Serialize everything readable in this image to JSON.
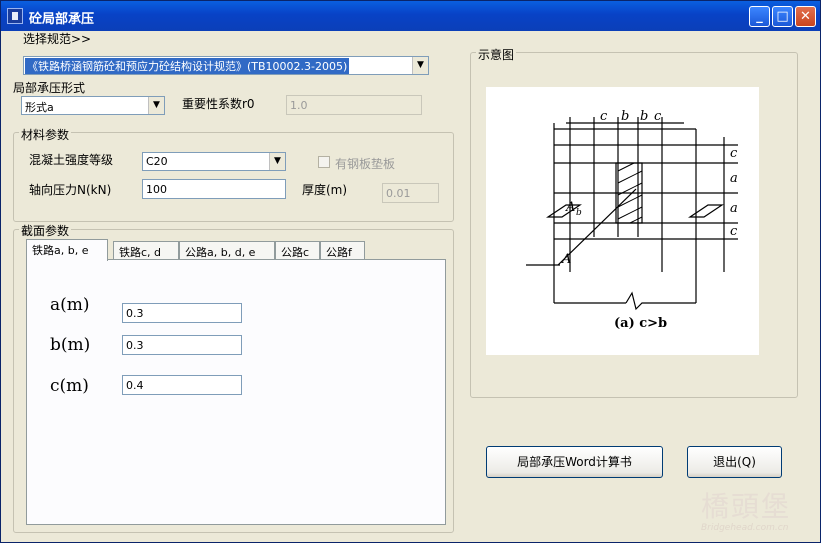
{
  "window": {
    "title": "砼局部承压",
    "buttons": {
      "minimize": "_",
      "maximize": "□",
      "close": "✕"
    }
  },
  "spec": {
    "label": "选择规范>>",
    "value": "《铁路桥涵钢筋砼和预应力砼结构设计规范》(TB10002.3-2005)"
  },
  "form_type": {
    "label": "局部承压形式",
    "value": "形式a"
  },
  "importance": {
    "label": "重要性系数r0",
    "value": "1.0"
  },
  "materials": {
    "title": "材料参数",
    "concrete_label": "混凝土强度等级",
    "concrete_value": "C20",
    "steel_plate_label": "有钢板垫板",
    "axial_label": "轴向压力N(kN)",
    "axial_value": "100",
    "thickness_label": "厚度(m)",
    "thickness_value": "0.01"
  },
  "section": {
    "title": "截面参数",
    "tabs": [
      "铁路a, b, e",
      "铁路c, d",
      "公路a, b, d, e",
      "公路c",
      "公路f"
    ],
    "params": [
      {
        "label": "a(m)",
        "value": "0.3"
      },
      {
        "label": "b(m)",
        "value": "0.3"
      },
      {
        "label": "c(m)",
        "value": "0.4"
      }
    ]
  },
  "diagram": {
    "title": "示意图",
    "caption": "(a) c>b",
    "labels": {
      "c": "c",
      "b": "b",
      "a": "a",
      "Ab": "A",
      "Ab_sub": "b",
      "A": "A"
    }
  },
  "actions": {
    "report_label": "局部承压Word计算书",
    "exit_label": "退出(Q)"
  },
  "watermark": {
    "line1": "橋頭堡",
    "line2": "Bridgehead.com.cn"
  }
}
